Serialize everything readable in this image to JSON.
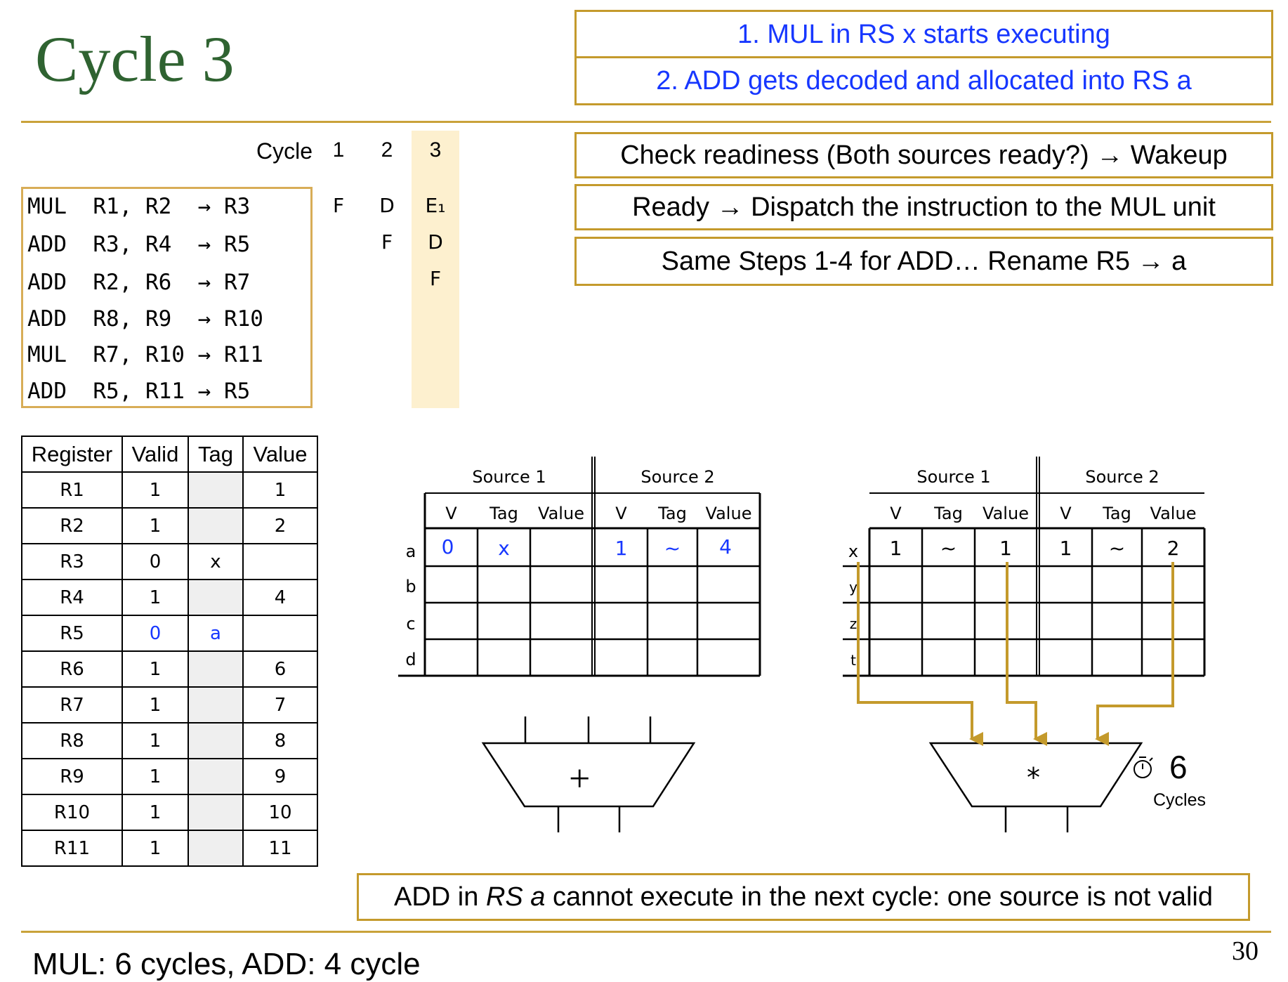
{
  "title": "Cycle 3",
  "notes_top": [
    "1. MUL in RS x starts executing",
    "2. ADD gets decoded and allocated into RS a"
  ],
  "notes_mid": [
    "Check readiness (Both sources ready?) → Wakeup",
    "Ready → Dispatch the instruction to the MUL unit",
    "Same Steps 1-4 for ADD… Rename R5 → a"
  ],
  "pipeline": {
    "cycle_label": "Cycle",
    "cycles": [
      "1",
      "2",
      "3"
    ],
    "highlight_cycle": "3",
    "instructions": [
      {
        "text": "MUL  R1, R2  → R3",
        "stages": [
          "F",
          "D",
          "E₁"
        ]
      },
      {
        "text": "ADD  R3, R4  → R5",
        "stages": [
          "",
          "F",
          "D"
        ]
      },
      {
        "text": "ADD  R2, R6  → R7",
        "stages": [
          "",
          "",
          "F"
        ]
      },
      {
        "text": "ADD  R8, R9  → R10",
        "stages": [
          "",
          "",
          ""
        ]
      },
      {
        "text": "MUL  R7, R10 → R11",
        "stages": [
          "",
          "",
          ""
        ]
      },
      {
        "text": "ADD  R5, R11 → R5",
        "stages": [
          "",
          "",
          ""
        ]
      }
    ]
  },
  "register_file": {
    "headers": [
      "Register",
      "Valid",
      "Tag",
      "Value"
    ],
    "rows": [
      [
        "R1",
        "1",
        "",
        "1"
      ],
      [
        "R2",
        "1",
        "",
        "2"
      ],
      [
        "R3",
        "0",
        "x",
        ""
      ],
      [
        "R4",
        "1",
        "",
        "4"
      ],
      [
        "R5",
        "0",
        "a",
        ""
      ],
      [
        "R6",
        "1",
        "",
        "6"
      ],
      [
        "R7",
        "1",
        "",
        "7"
      ],
      [
        "R8",
        "1",
        "",
        "8"
      ],
      [
        "R9",
        "1",
        "",
        "9"
      ],
      [
        "R10",
        "1",
        "",
        "10"
      ],
      [
        "R11",
        "1",
        "",
        "11"
      ]
    ],
    "highlight_row": "R5"
  },
  "rs_add": {
    "group_headers": [
      "Source 1",
      "Source 2"
    ],
    "col_headers": [
      "V",
      "Tag",
      "Value",
      "V",
      "Tag",
      "Value"
    ],
    "entries": [
      {
        "id": "a",
        "cells": [
          "0",
          "x",
          "",
          "1",
          "~",
          "4"
        ]
      },
      {
        "id": "b",
        "cells": [
          "",
          "",
          "",
          "",
          "",
          ""
        ]
      },
      {
        "id": "c",
        "cells": [
          "",
          "",
          "",
          "",
          "",
          ""
        ]
      },
      {
        "id": "d",
        "cells": [
          "",
          "",
          "",
          "",
          "",
          ""
        ]
      }
    ],
    "unit_symbol": "+"
  },
  "rs_mul": {
    "group_headers": [
      "Source 1",
      "Source 2"
    ],
    "col_headers": [
      "V",
      "Tag",
      "Value",
      "V",
      "Tag",
      "Value"
    ],
    "entries": [
      {
        "id": "x",
        "cells": [
          "1",
          "~",
          "1",
          "1",
          "~",
          "2"
        ]
      },
      {
        "id": "y",
        "cells": [
          "",
          "",
          "",
          "",
          "",
          ""
        ]
      },
      {
        "id": "z",
        "cells": [
          "",
          "",
          "",
          "",
          "",
          ""
        ]
      },
      {
        "id": "t",
        "cells": [
          "",
          "",
          "",
          "",
          "",
          ""
        ]
      }
    ],
    "unit_symbol": "*",
    "latency": "6",
    "latency_label": "Cycles"
  },
  "note_bottom_parts": [
    "ADD in ",
    "RS a",
    " cannot execute in the next cycle: one source is not valid"
  ],
  "footer": "MUL: 6 cycles,  ADD: 4 cycle",
  "page_number": "30",
  "colors": {
    "title": "#2f6331",
    "accent": "#c9a23a",
    "highlight": "#fdf0cf",
    "blue_text": "#1737ff",
    "arrow": "#c49a2c"
  }
}
